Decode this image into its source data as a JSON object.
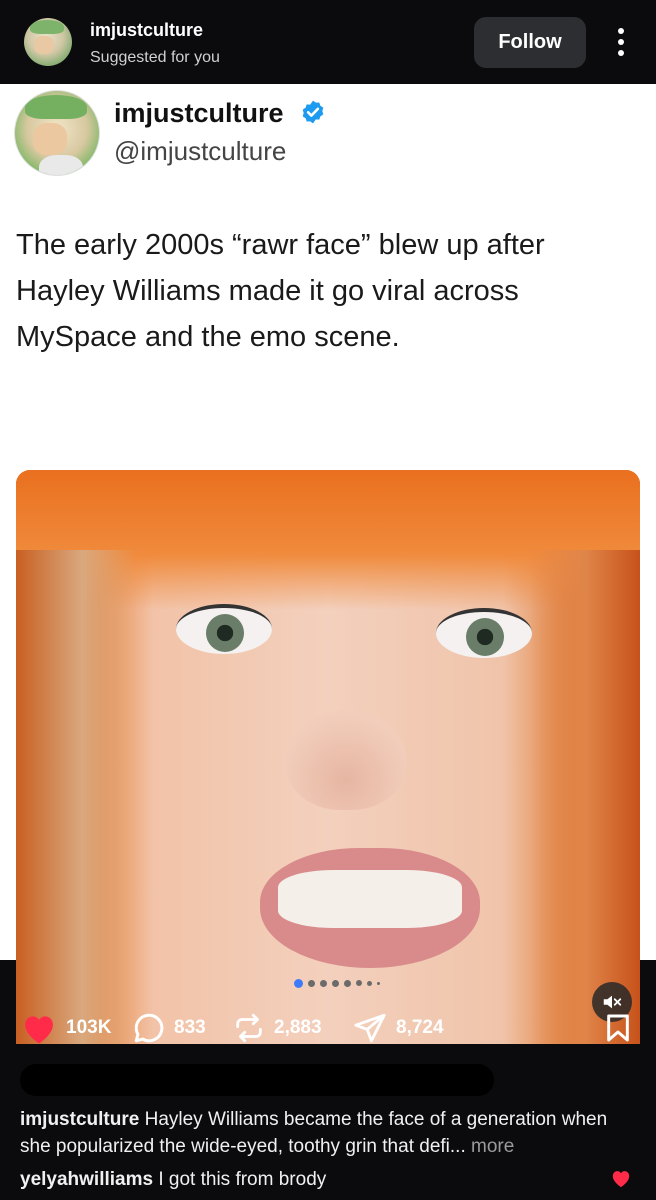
{
  "header": {
    "username": "imjustculture",
    "subtitle": "Suggested for you",
    "follow_label": "Follow"
  },
  "tweet": {
    "display_name": "imjustculture",
    "handle": "@imjustculture",
    "text": "The early 2000s “rawr face” blew up after Hayley Williams made it go viral across MySpace and the emo scene."
  },
  "carousel": {
    "total_dots": 8,
    "active_index": 0
  },
  "actions": {
    "likes": "103K",
    "comments": "833",
    "reposts": "2,883",
    "shares": "8,724"
  },
  "caption": {
    "author": "imjustculture",
    "text": " Hayley Williams became the face of a generation when she popularized the wide-eyed, toothy grin that defi...",
    "more_label": " more"
  },
  "top_comment": {
    "author": "yelyahwilliams",
    "text": " I got this from brody"
  },
  "colors": {
    "like_red": "#ff2b49",
    "verified_blue": "#1d9bf0",
    "active_dot": "#3e7bfa"
  }
}
